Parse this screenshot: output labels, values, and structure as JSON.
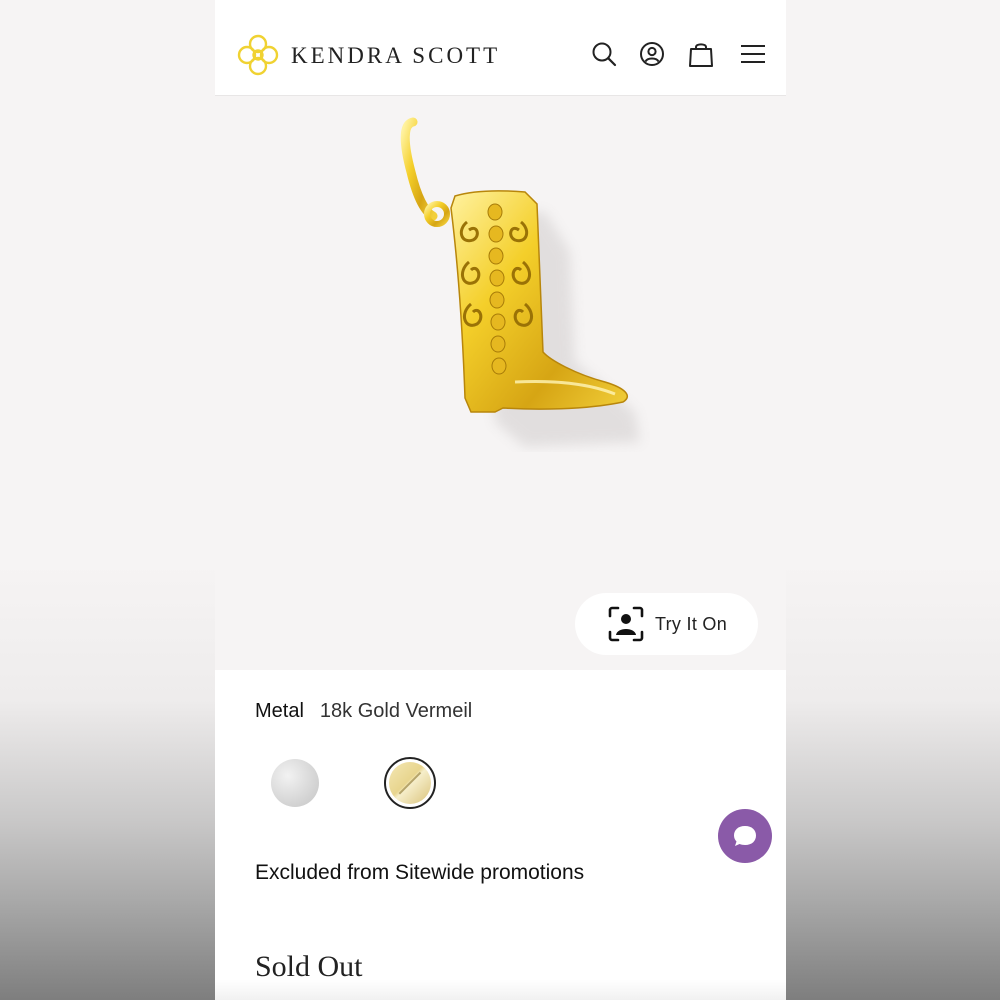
{
  "header": {
    "brand": "KENDRA SCOTT",
    "icons": [
      "search-icon",
      "account-icon",
      "shopping-bag-icon",
      "menu-icon"
    ]
  },
  "product": {
    "image_description_icon": "boot-charm-image",
    "try_on_label": "Try It On"
  },
  "options": {
    "metal_label": "Metal",
    "metal_value": "18k Gold Vermeil",
    "swatches": [
      {
        "name": "silver",
        "selected": false
      },
      {
        "name": "gold",
        "selected": true
      }
    ]
  },
  "promo_note": "Excluded from Sitewide promotions",
  "status": "Sold Out",
  "colors": {
    "brand_gold": "#f0d232",
    "chat_purple": "#8a5aa8",
    "text_dark": "#222222"
  }
}
